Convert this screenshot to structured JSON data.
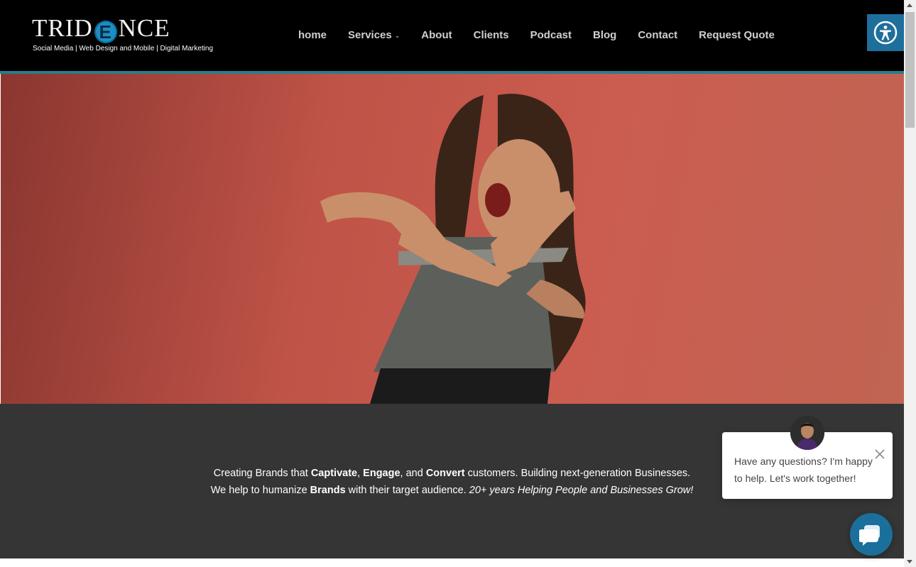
{
  "brand": {
    "logo_text_before": "TRID",
    "logo_mark": "E",
    "logo_text_after": "NCE",
    "tagline": "Social Media | Web Design and Mobile | Digital Marketing"
  },
  "nav": {
    "items": [
      {
        "label": "home"
      },
      {
        "label": "Services",
        "has_dropdown": true,
        "dropdown_icon": "chevron-down-icon"
      },
      {
        "label": "About"
      },
      {
        "label": "Clients"
      },
      {
        "label": "Podcast"
      },
      {
        "label": "Blog"
      },
      {
        "label": "Contact"
      },
      {
        "label": "Request Quote"
      }
    ]
  },
  "accessibility": {
    "icon": "accessibility-icon"
  },
  "hero": {
    "media": "video-woman-dancing",
    "background": "#c2564a"
  },
  "intro": {
    "line1": {
      "t1": "Creating Brands that ",
      "b1": "Captivate",
      "t2": ", ",
      "b2": "Engage",
      "t3": ", and ",
      "b3": "Convert",
      "t4": " customers. Building next-generation Businesses."
    },
    "line2": {
      "t1": "We help to humanize ",
      "b1": "Brands",
      "t2": " with their target audience. ",
      "i1": "20+ years Helping People and Businesses Grow!"
    }
  },
  "chat": {
    "message": "Have any questions? I'm happy to help. Let's work together!",
    "close_icon": "close-icon",
    "launcher_icon": "chat-icon"
  },
  "colors": {
    "header_bg": "#000000",
    "accent_line": "#2a7d8c",
    "nav_text": "#cfcfcf",
    "intro_bg": "#353535",
    "chat_accent": "#1b6f9b"
  }
}
